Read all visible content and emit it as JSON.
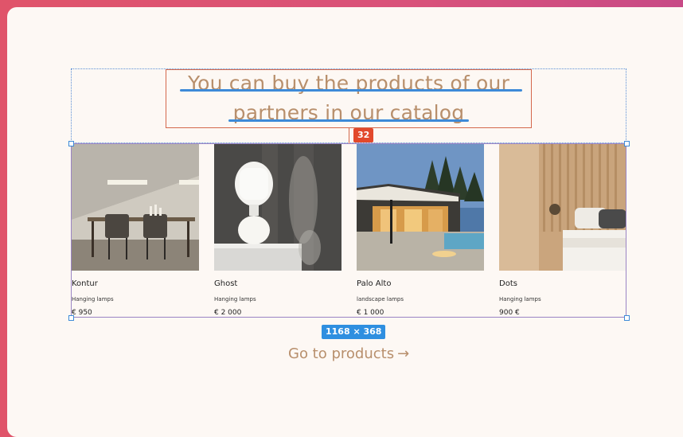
{
  "heading": {
    "line1": "You can buy the products of our",
    "line2": "partners in our catalog"
  },
  "spacing_badge": "32",
  "size_badge": "1168 × 368",
  "products": [
    {
      "name": "Kontur",
      "category": "Hanging lamps",
      "price": "€ 950"
    },
    {
      "name": "Ghost",
      "category": "Hanging lamps",
      "price": "€ 2 000"
    },
    {
      "name": "Palo Alto",
      "category": "landscape lamps",
      "price": "€ 1 000"
    },
    {
      "name": "Dots",
      "category": "Hanging lamps",
      "price": "900 €"
    }
  ],
  "cta": {
    "label": "Go to products",
    "arrow": "→"
  },
  "colors": {
    "accent_text": "#b88f6c",
    "selection_blue": "#3d8ad8",
    "spacing_red": "#e2492c",
    "background": "#fdf8f4"
  }
}
